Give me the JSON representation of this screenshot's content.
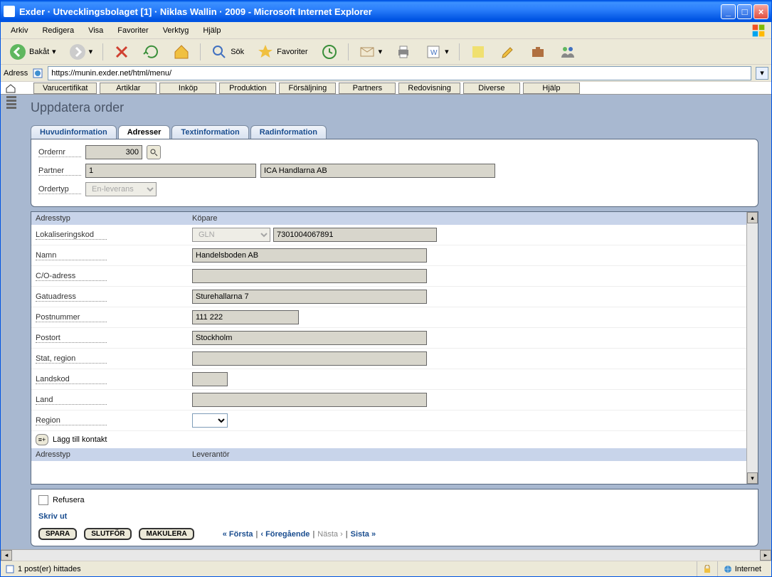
{
  "window": {
    "title": "Exder · Utvecklingsbolaget [1] · Niklas Wallin · 2009 - Microsoft Internet Explorer"
  },
  "menubar": {
    "items": [
      "Arkiv",
      "Redigera",
      "Visa",
      "Favoriter",
      "Verktyg",
      "Hjälp"
    ]
  },
  "toolbar": {
    "back": "Bakåt",
    "search": "Sök",
    "favorites": "Favoriter"
  },
  "addressbar": {
    "label": "Adress",
    "url": "https://munin.exder.net/html/menu/"
  },
  "appnav": {
    "items": [
      "Varucertifikat",
      "Artiklar",
      "Inköp",
      "Produktion",
      "Försäljning",
      "Partners",
      "Redovisning",
      "Diverse",
      "Hjälp"
    ]
  },
  "page": {
    "title": "Uppdatera order",
    "tabs": [
      "Huvudinformation",
      "Adresser",
      "Textinformation",
      "Radinformation"
    ],
    "activeTab": 1,
    "header": {
      "ordernr_label": "Ordernr",
      "ordernr_value": "300",
      "partner_label": "Partner",
      "partner_id": "1",
      "partner_name": "ICA Handlarna AB",
      "ordertyp_label": "Ordertyp",
      "ordertyp_value": "En-leverans"
    },
    "address": {
      "header_col1": "Adresstyp",
      "header_col2": "Köpare",
      "rows": {
        "lok_label": "Lokaliseringskod",
        "lok_type": "GLN",
        "lok_value": "7301004067891",
        "namn_label": "Namn",
        "namn_value": "Handelsboden AB",
        "co_label": "C/O-adress",
        "co_value": "",
        "gata_label": "Gatuadress",
        "gata_value": "Sturehallarna 7",
        "postnr_label": "Postnummer",
        "postnr_value": "111 222",
        "postort_label": "Postort",
        "postort_value": "Stockholm",
        "stat_label": "Stat, region",
        "stat_value": "",
        "landskod_label": "Landskod",
        "landskod_value": "",
        "land_label": "Land",
        "land_value": "",
        "region_label": "Region",
        "region_value": ""
      },
      "addcontact_label": "Lägg till kontakt",
      "footer_col1": "Adresstyp",
      "footer_col2": "Leverantör"
    },
    "actions": {
      "refusera": "Refusera",
      "skrivut": "Skriv ut",
      "spara": "SPARA",
      "slutfor": "SLUTFÖR",
      "makulera": "MAKULERA",
      "pager_first": "« Första",
      "pager_prev": "‹ Föregående",
      "pager_next": "Nästa ›",
      "pager_last": "Sista »"
    }
  },
  "statusbar": {
    "status": "1 post(er) hittades",
    "zone": "Internet"
  }
}
